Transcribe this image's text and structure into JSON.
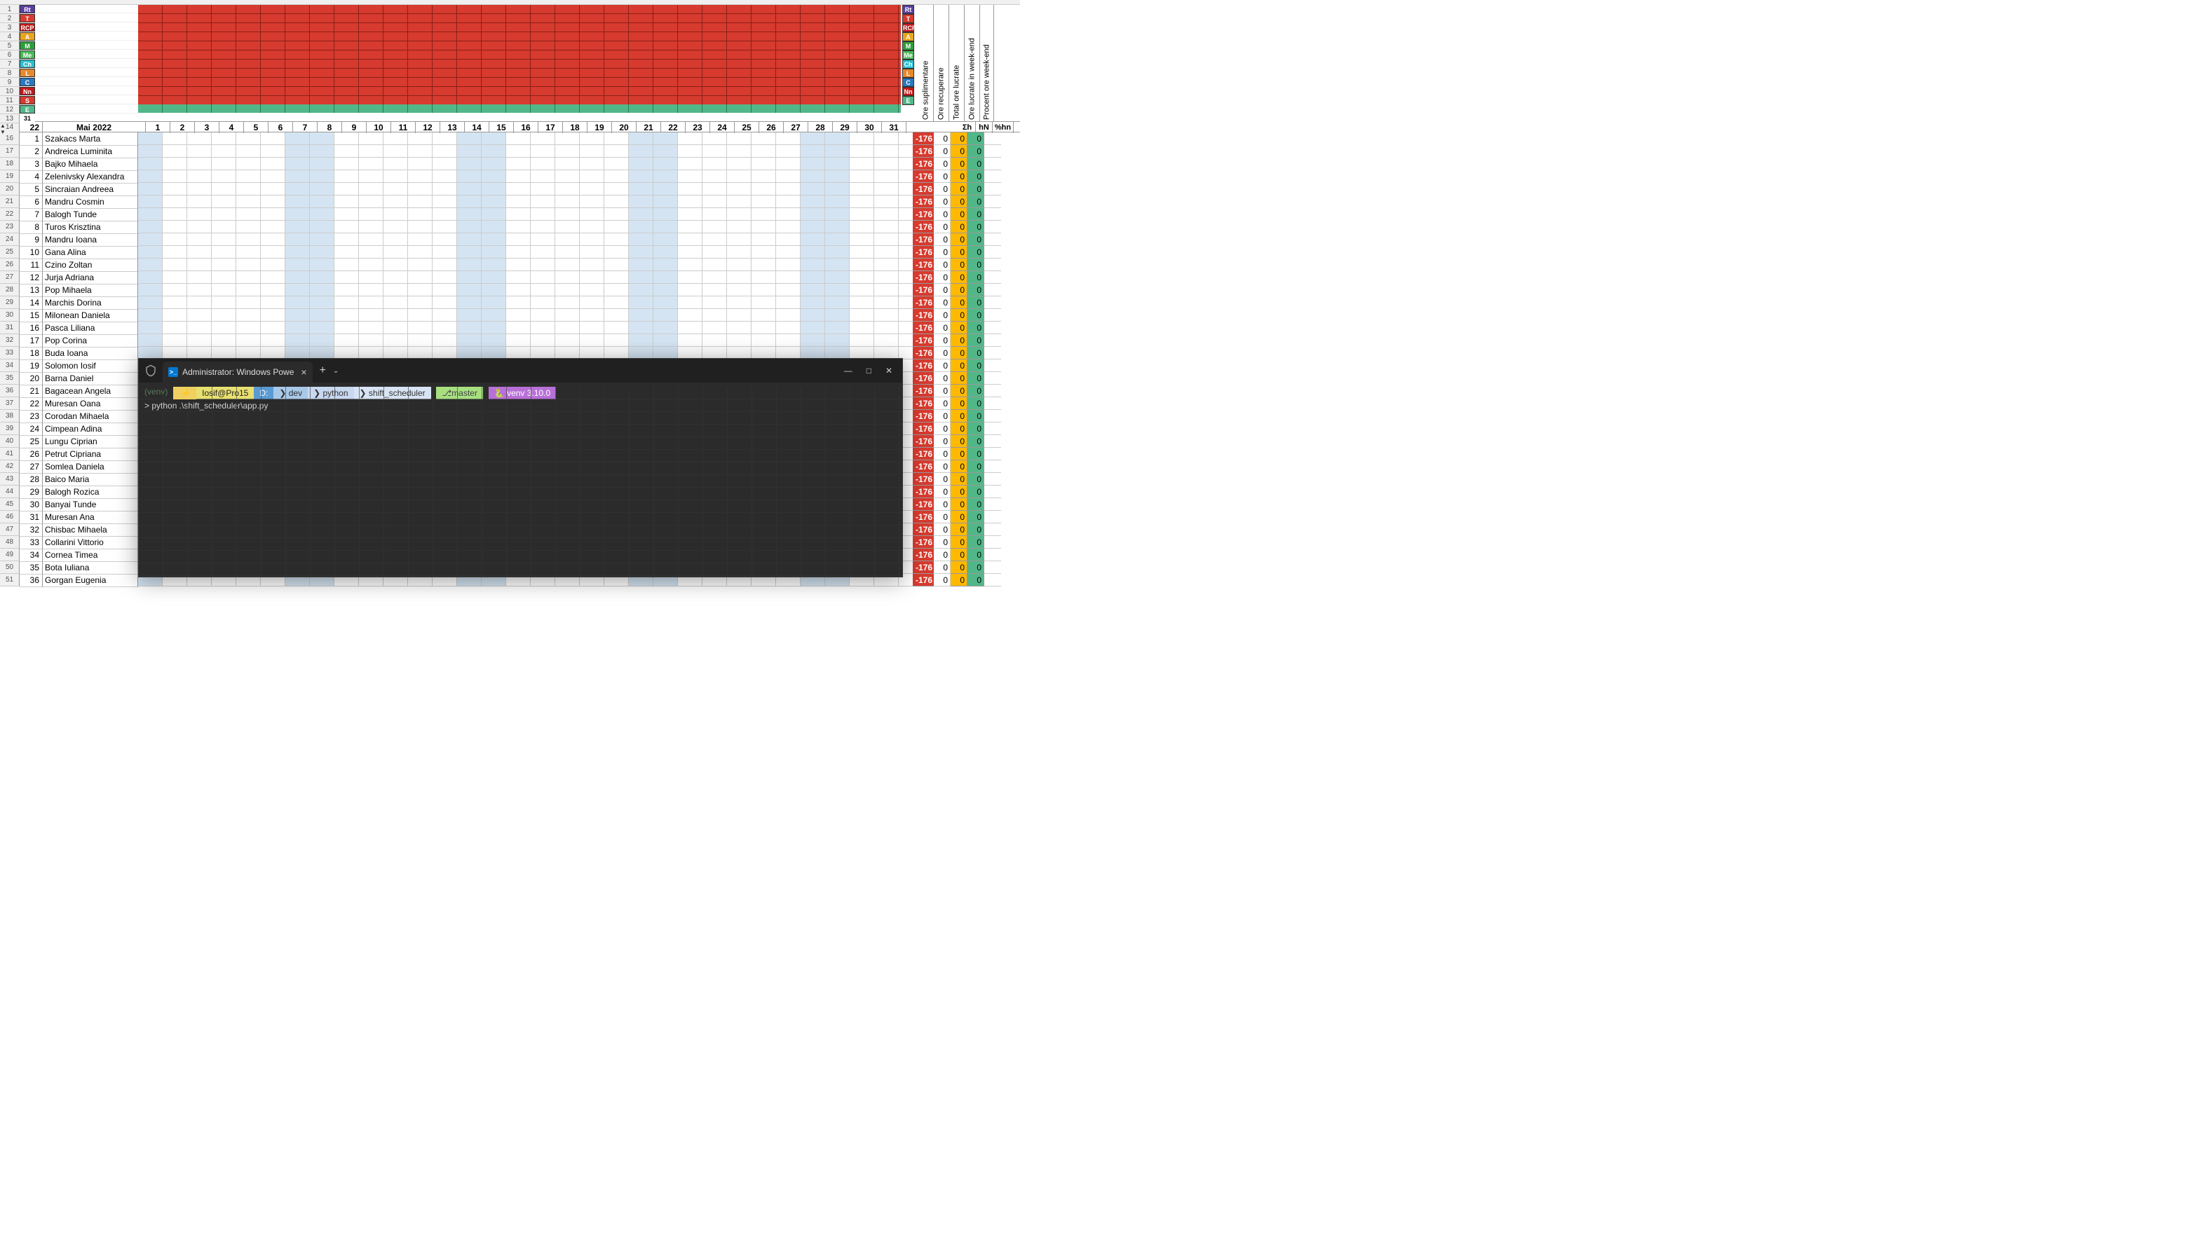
{
  "legend_left": [
    {
      "t": "Rt",
      "c": "#5a3fa0"
    },
    {
      "t": "T",
      "c": "#d73a2e"
    },
    {
      "t": "RCP",
      "c": "#c21a1a"
    },
    {
      "t": "A",
      "c": "#eaa520"
    },
    {
      "t": "M",
      "c": "#2e9e3a"
    },
    {
      "t": "Me",
      "c": "#4aba58"
    },
    {
      "t": "Ch",
      "c": "#2ac0d0"
    },
    {
      "t": "L",
      "c": "#e68a2e"
    },
    {
      "t": "C",
      "c": "#2a78c0"
    },
    {
      "t": "Nn",
      "c": "#c21a1a"
    },
    {
      "t": "S",
      "c": "#d73a2e"
    },
    {
      "t": "E",
      "c": "#52b788"
    }
  ],
  "legend_right": [
    {
      "t": "Rt",
      "c": "#5a3fa0"
    },
    {
      "t": "T",
      "c": "#d73a2e"
    },
    {
      "t": "RCP",
      "c": "#c21a1a"
    },
    {
      "t": "A",
      "c": "#eaa520"
    },
    {
      "t": "M",
      "c": "#2e9e3a"
    },
    {
      "t": "Me",
      "c": "#4aba58"
    },
    {
      "t": "Ch",
      "c": "#2ac0d0"
    },
    {
      "t": "L",
      "c": "#e68a2e"
    },
    {
      "t": "C",
      "c": "#2a78c0"
    },
    {
      "t": "Nn",
      "c": "#c21a1a"
    },
    {
      "t": "E",
      "c": "#52b788"
    }
  ],
  "row13_label": "31",
  "month_num": "22",
  "month_label": "Mai 2022",
  "days": [
    "1",
    "2",
    "3",
    "4",
    "5",
    "6",
    "7",
    "8",
    "9",
    "10",
    "11",
    "12",
    "13",
    "14",
    "15",
    "16",
    "17",
    "18",
    "19",
    "20",
    "21",
    "22",
    "23",
    "24",
    "25",
    "26",
    "27",
    "28",
    "29",
    "30",
    "31"
  ],
  "weekend_days": [
    "1",
    "7",
    "8",
    "14",
    "15",
    "21",
    "22",
    "28",
    "29"
  ],
  "people": [
    {
      "r": 16,
      "i": 1,
      "n": "Szakacs Marta"
    },
    {
      "r": 17,
      "i": 2,
      "n": "Andreica Luminita"
    },
    {
      "r": 18,
      "i": 3,
      "n": "Bajko Mihaela"
    },
    {
      "r": 19,
      "i": 4,
      "n": "Zelenivsky Alexandra"
    },
    {
      "r": 20,
      "i": 5,
      "n": "Sincraian Andreea"
    },
    {
      "r": 21,
      "i": 6,
      "n": "Mandru Cosmin"
    },
    {
      "r": 22,
      "i": 7,
      "n": "Balogh Tunde"
    },
    {
      "r": 23,
      "i": 8,
      "n": "Turos Krisztina"
    },
    {
      "r": 24,
      "i": 9,
      "n": "Mandru Ioana"
    },
    {
      "r": 25,
      "i": 10,
      "n": "Gana Alina"
    },
    {
      "r": 26,
      "i": 11,
      "n": "Czino Zoltan"
    },
    {
      "r": 27,
      "i": 12,
      "n": "Jurja Adriana"
    },
    {
      "r": 28,
      "i": 13,
      "n": "Pop Mihaela"
    },
    {
      "r": 29,
      "i": 14,
      "n": "Marchis Dorina"
    },
    {
      "r": 30,
      "i": 15,
      "n": "Milonean Daniela"
    },
    {
      "r": 31,
      "i": 16,
      "n": "Pasca Liliana"
    },
    {
      "r": 32,
      "i": 17,
      "n": "Pop Corina"
    },
    {
      "r": 33,
      "i": 18,
      "n": "Buda Ioana"
    },
    {
      "r": 34,
      "i": 19,
      "n": "Solomon Iosif"
    },
    {
      "r": 35,
      "i": 20,
      "n": "Barna Daniel"
    },
    {
      "r": 36,
      "i": 21,
      "n": "Bagacean Angela"
    },
    {
      "r": 37,
      "i": 22,
      "n": "Muresan Oana"
    },
    {
      "r": 38,
      "i": 23,
      "n": "Corodan Mihaela"
    },
    {
      "r": 39,
      "i": 24,
      "n": "Cimpean Adina"
    },
    {
      "r": 40,
      "i": 25,
      "n": "Lungu Ciprian"
    },
    {
      "r": 41,
      "i": 26,
      "n": "Petrut Cipriana"
    },
    {
      "r": 42,
      "i": 27,
      "n": "Somlea Daniela"
    },
    {
      "r": 43,
      "i": 28,
      "n": "Baico Maria"
    },
    {
      "r": 44,
      "i": 29,
      "n": "Balogh Rozica"
    },
    {
      "r": 45,
      "i": 30,
      "n": "Banyai Tunde"
    },
    {
      "r": 46,
      "i": 31,
      "n": "Muresan Ana"
    },
    {
      "r": 47,
      "i": 32,
      "n": "Chisbac Mihaela"
    },
    {
      "r": 48,
      "i": 33,
      "n": "Collarini Vittorio"
    },
    {
      "r": 49,
      "i": 34,
      "n": "Cornea Timea"
    },
    {
      "r": 50,
      "i": 35,
      "n": "Bota Iuliana"
    },
    {
      "r": 51,
      "i": 36,
      "n": "Gorgan Eugenia"
    }
  ],
  "right_headers": [
    "Ore suplimentare",
    "Ore recuperare",
    "Total ore lucrate",
    "Ore lucrate in week-end",
    "Procent ore week-end"
  ],
  "sum_headers": [
    "Σh",
    "hN",
    "%hn"
  ],
  "sum_vals": {
    "a": "-176",
    "b": "0",
    "c": "0",
    "d": "0"
  },
  "terminal": {
    "tab_title": "Administrator: Windows Powe",
    "venv": "(venv)",
    "user": "Iosif@Pro15",
    "drive": "D:",
    "p1": "dev",
    "p2": "python",
    "p3": "shift_scheduler",
    "branch": "master",
    "pyenv": "venv 3.10.0",
    "cmd": "python .\\shift_scheduler\\app.py",
    "prompt": ">"
  }
}
